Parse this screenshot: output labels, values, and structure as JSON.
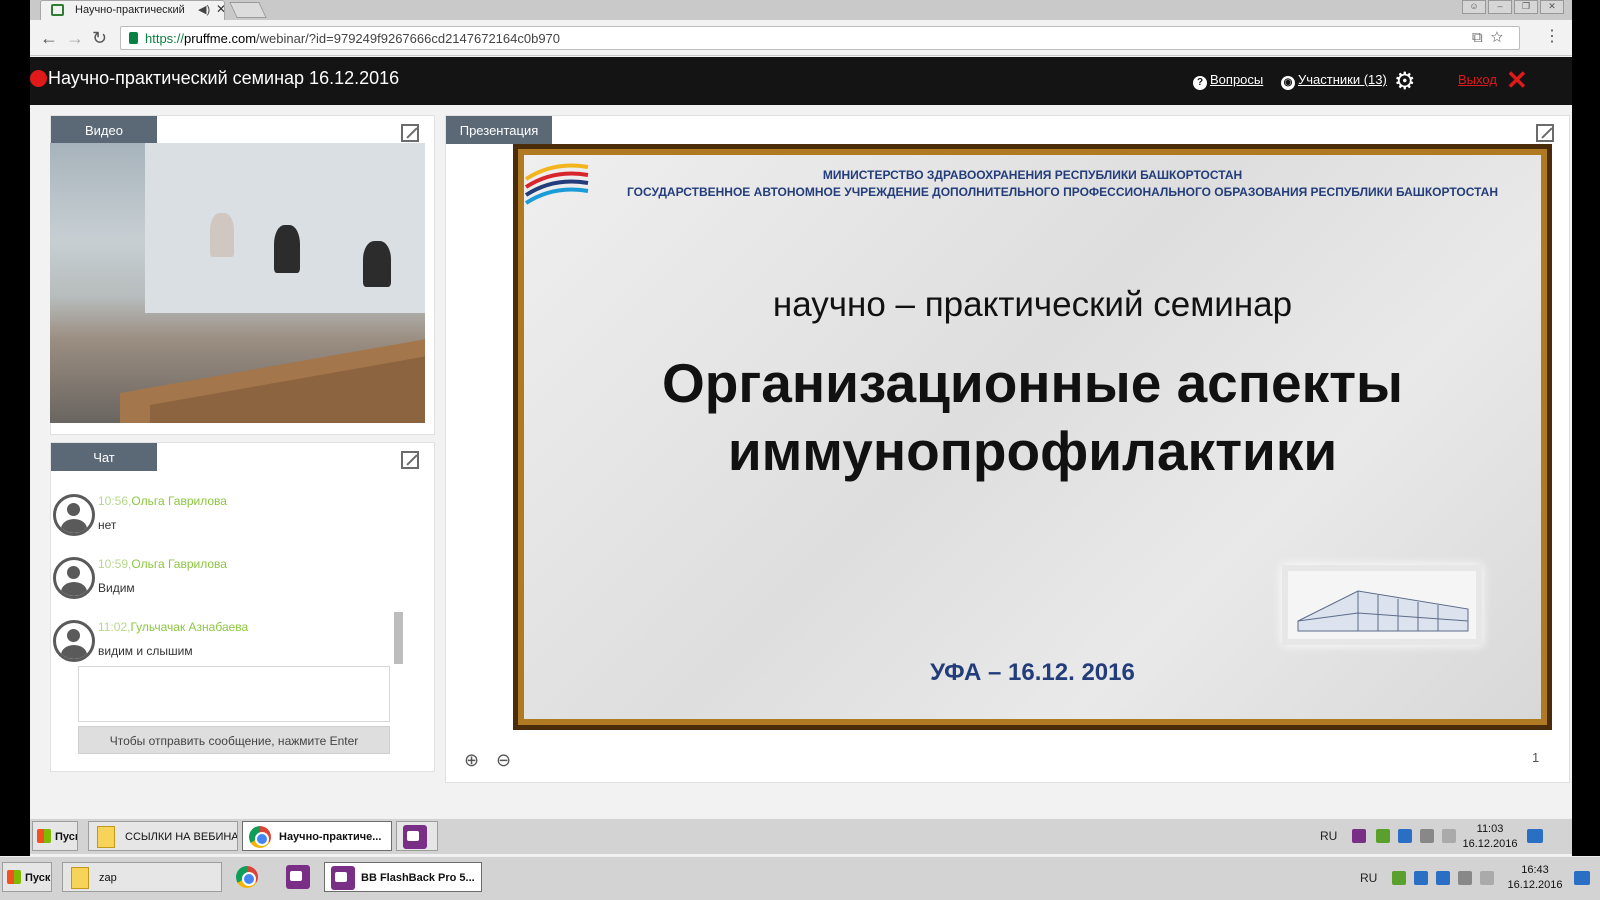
{
  "browser": {
    "tab_title": "Научно-практический",
    "url_https": "https://",
    "url_host": "pruffme.com",
    "url_path": "/webinar/?id=979249f9267666cd2147672164c0b970"
  },
  "webinar": {
    "title": "Научно-практический семинар 16.12.2016",
    "questions_label": "Вопросы",
    "participants_label": "Участники (13)",
    "exit_label": "Выход"
  },
  "video_panel": {
    "tab_label": "Видео"
  },
  "chat_panel": {
    "tab_label": "Чат",
    "messages": [
      {
        "time": "10:56,",
        "author": "Ольга Гаврилова",
        "text": "нет"
      },
      {
        "time": "10:59,",
        "author": "Ольга Гаврилова",
        "text": "Видим"
      },
      {
        "time": "11:02,",
        "author": "Гульчачак Азнабаева",
        "text": "видим и слышим"
      }
    ],
    "send_hint": "Чтобы отправить сообщение, нажмите Enter"
  },
  "presentation": {
    "tab_label": "Презентация",
    "ministry_line1": "МИНИСТЕРСТВО ЗДРАВООХРАНЕНИЯ РЕСПУБЛИКИ БАШКОРТОСТАН",
    "ministry_line2": "ГОСУДАРСТВЕННОЕ АВТОНОМНОЕ УЧРЕЖДЕНИЕ ДОПОЛНИТЕЛЬНОГО ПРОФЕССИОНАЛЬНОГО ОБРАЗОВАНИЯ РЕСПУБЛИКИ БАШКОРТОСТАН",
    "subtitle": "научно – практический семинар",
    "title_line1": "Организационные аспекты",
    "title_line2": "иммунопрофилактики",
    "place_date": "УФА – 16.12. 2016",
    "page": "1"
  },
  "taskbar_inner": {
    "start": "Пуск",
    "items": [
      "ССЫЛКИ НА ВЕБИНАРЫ",
      "Научно-практиче..."
    ],
    "lang": "RU",
    "time": "11:03",
    "date": "16.12.2016"
  },
  "taskbar_outer": {
    "start": "Пуск",
    "items": [
      "zap",
      "BB FlashBack Pro 5..."
    ],
    "lang": "RU",
    "time": "16:43",
    "date": "16.12.2016"
  }
}
